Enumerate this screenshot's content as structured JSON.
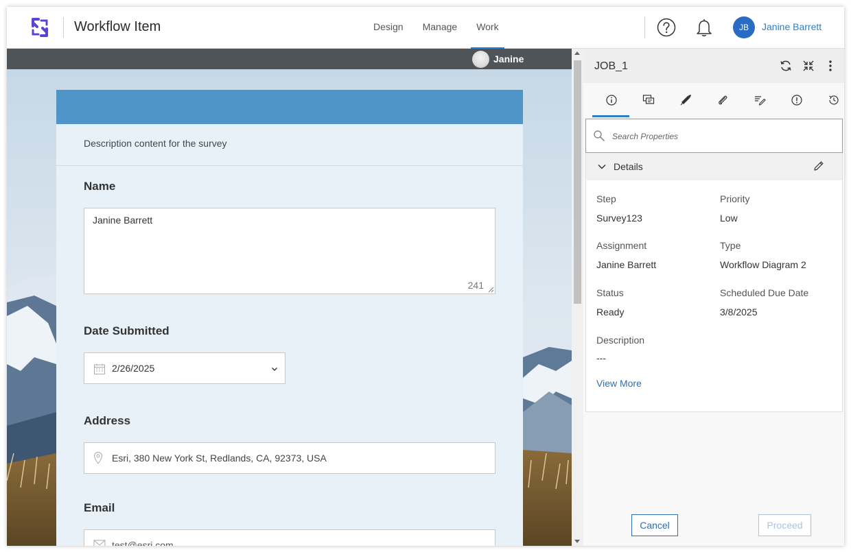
{
  "header": {
    "app_title": "Workflow Item",
    "nav": [
      {
        "label": "Design"
      },
      {
        "label": "Manage"
      },
      {
        "label": "Work"
      }
    ],
    "user_initials": "JB",
    "user_name": "Janine Barrett"
  },
  "survey": {
    "top_user": "Janine",
    "description": "Description content for the survey",
    "questions": {
      "name": {
        "label": "Name",
        "value": "Janine Barrett",
        "char_count": "241"
      },
      "date": {
        "label": "Date Submitted",
        "value": "2/26/2025"
      },
      "address": {
        "label": "Address",
        "value": "Esri, 380 New York St, Redlands, CA, 92373, USA"
      },
      "email": {
        "label": "Email",
        "value": "test@esri.com"
      }
    }
  },
  "panel": {
    "job_title": "JOB_1",
    "search_placeholder": "Search Properties",
    "details_title": "Details",
    "props": {
      "step_label": "Step",
      "step_value": "Survey123",
      "priority_label": "Priority",
      "priority_value": "Low",
      "assignment_label": "Assignment",
      "assignment_value": "Janine Barrett",
      "type_label": "Type",
      "type_value": "Workflow Diagram 2",
      "status_label": "Status",
      "status_value": "Ready",
      "due_label": "Scheduled Due Date",
      "due_value": "3/8/2025",
      "description_label": "Description",
      "description_value": "---"
    },
    "view_more": "View More",
    "cancel_label": "Cancel",
    "proceed_label": "Proceed"
  },
  "colors": {
    "accent": "#2f7ec2",
    "form_header": "#4f95c7",
    "survey_bar": "#4f5458"
  }
}
